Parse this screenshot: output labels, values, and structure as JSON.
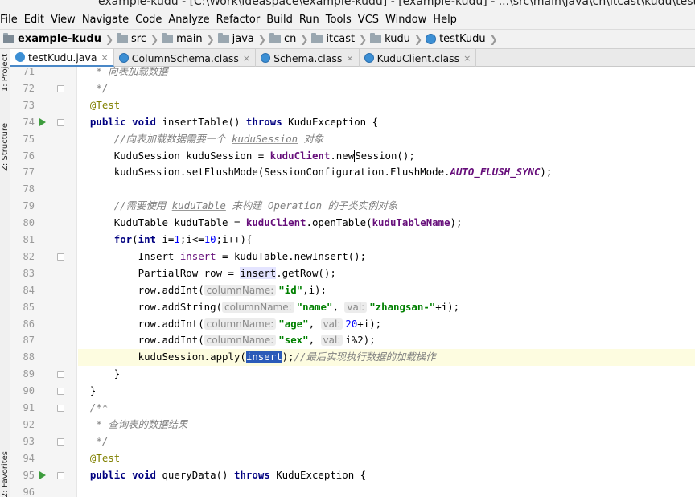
{
  "window": {
    "title": "example-kudu - [C:\\Work\\ideaspace\\example-kudu] - [example-kudu] - ...\\src\\main\\java\\cn\\itcast\\kudu\\testKudu"
  },
  "menu": [
    "File",
    "Edit",
    "View",
    "Navigate",
    "Code",
    "Analyze",
    "Refactor",
    "Build",
    "Run",
    "Tools",
    "VCS",
    "Window",
    "Help"
  ],
  "breadcrumb": [
    "example-kudu",
    "src",
    "main",
    "java",
    "cn",
    "itcast",
    "kudu",
    "testKudu"
  ],
  "tool_tabs": {
    "project": "1: Project",
    "structure": "Z: Structure",
    "favorites": "2: Favorites"
  },
  "tabs": [
    {
      "label": "testKudu.java",
      "active": true,
      "close": "×"
    },
    {
      "label": "ColumnSchema.class",
      "active": false,
      "close": "×"
    },
    {
      "label": "Schema.class",
      "active": false,
      "close": "×"
    },
    {
      "label": "KuduClient.class",
      "active": false,
      "close": "×"
    }
  ],
  "editor": {
    "line_numbers": [
      "71",
      "72",
      "73",
      "74",
      "75",
      "76",
      "77",
      "78",
      "79",
      "80",
      "81",
      "82",
      "83",
      "84",
      "85",
      "86",
      "87",
      "88",
      "89",
      "90",
      "91",
      "92",
      "93",
      "94",
      "95",
      "96"
    ],
    "current_line": "88",
    "tokens": {
      "c71": "   * 向表加载数据",
      "c72": "   */",
      "ann": "@Test",
      "public": "public",
      "void": "void",
      "throws": "throws",
      "insertTable": " insertTable() ",
      "kuduException": " KuduException {",
      "c75": "//向表加载数据需要一个 ",
      "c75b": "kuduSession",
      "c75c": " 对象",
      "l76a": "KuduSession kuduSession = ",
      "kuduClient": "kuduClient",
      "l76b": ".new",
      "l76c": "Session();",
      "l77a": "kuduSession.setFlushMode(SessionConfiguration.FlushMode.",
      "autoFlush": "AUTO_FLUSH_SYNC",
      "l77b": ");",
      "c79a": "//需要使用 ",
      "c79b": "kuduTable",
      "c79c": " 来构建 Operation 的子类实例对象",
      "l80a": "KuduTable kuduTable = ",
      "l80b": ".openTable(",
      "kuduTableName": "kuduTableName",
      "l80c": ");",
      "for": "for",
      "int": "int",
      "l81a": "(",
      "l81b": " i=",
      "one": "1",
      "l81c": ";i<=",
      "ten": "10",
      "l81d": ";i++){",
      "l82a": "Insert ",
      "insertVar": "insert",
      "l82b": " = kuduTable.newInsert();",
      "l83a": "PartialRow row = ",
      "l83b": ".getRow();",
      "addInt": "row.addInt(",
      "addString": "row.addString(",
      "hint_colname": "columnName:",
      "hint_val": "val:",
      "s_id": "\"id\"",
      "s_name": "\"name\"",
      "s_zhangsan": "\"zhangsan-\"",
      "s_age": "\"age\"",
      "s_sex": "\"sex\"",
      "l84b": ",i);",
      "comma": ", ",
      "l85c": "+i);",
      "twenty": "20",
      "l86c": "+i);",
      "l87c": "i%2);",
      "l88a": "kuduSession.apply(",
      "l88b": ");",
      "c88": "//最后实现执行数据的加载操作",
      "brace_close": "}",
      "c91": "/**",
      "c92": " * 查询表的数据结果",
      "c93": " */",
      "queryData": " queryData() ",
      "l95end": " KuduException {"
    }
  }
}
